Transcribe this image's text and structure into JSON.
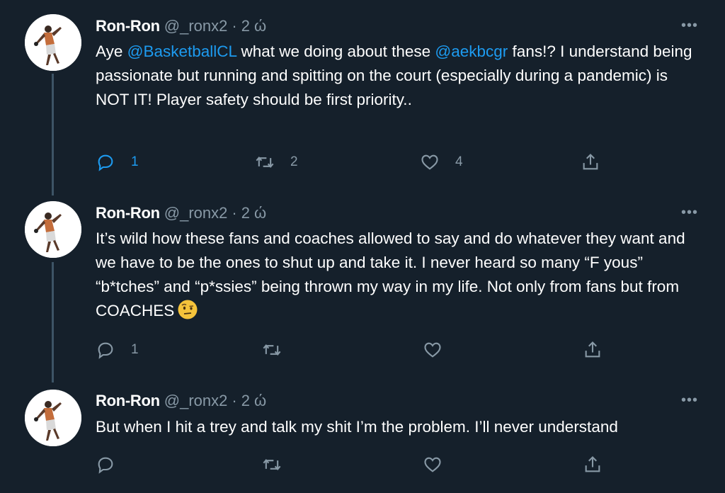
{
  "tweets": [
    {
      "name": "Ron-Ron",
      "handle": "@_ronx2",
      "dot": "·",
      "time": "2 ώ",
      "more": "•••",
      "text_parts": {
        "p1": "Aye ",
        "m1": "@BasketballCL",
        "p2": " what we doing about these ",
        "m2": "@aekbcgr",
        "p3": " fans!? I understand being passionate but running and spitting on the court (especially during a pandemic) is NOT IT! Player safety should be first priority.."
      },
      "reply_count": "1",
      "retweet_count": "2",
      "like_count": "4"
    },
    {
      "name": "Ron-Ron",
      "handle": "@_ronx2",
      "dot": "·",
      "time": "2 ώ",
      "more": "•••",
      "text": "It’s wild how these fans and coaches allowed to say and do whatever they want and we have to be the ones to shut up and take it. I never heard so many “F yous” “b*tches” and “p*ssies” being thrown my way in my life. Not only from fans but from COACHES",
      "emoji": "face-with-raised-eyebrow-emoji",
      "reply_count": "1"
    },
    {
      "name": "Ron-Ron",
      "handle": "@_ronx2",
      "dot": "·",
      "time": "2 ώ",
      "more": "•••",
      "text": "But when I hit a trey and talk my shit I’m the problem. I’ll never understand"
    }
  ],
  "icons": {
    "reply": "reply-icon",
    "retweet": "retweet-icon",
    "like": "heart-icon",
    "share": "share-icon",
    "more": "more-icon"
  },
  "colors": {
    "background": "#15202b",
    "mention": "#1d9bf0",
    "secondary_text": "#8899a6",
    "thread_line": "#3d5466"
  }
}
